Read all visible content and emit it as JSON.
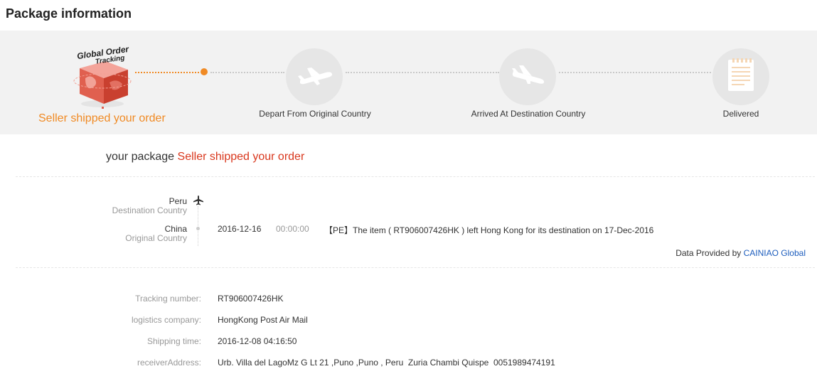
{
  "page_title": "Package information",
  "progress": {
    "logo_text": [
      "Global Order",
      "Tracking"
    ],
    "steps": [
      {
        "label": "Seller shipped your order",
        "icon": "global-order-tracking-icon",
        "state": "current"
      },
      {
        "label": "Depart From Original Country",
        "icon": "airplane-takeoff-icon",
        "state": "pending"
      },
      {
        "label": "Arrived At Destination Country",
        "icon": "airplane-landing-icon",
        "state": "pending"
      },
      {
        "label": "Delivered",
        "icon": "receipt-icon",
        "state": "pending"
      }
    ],
    "accent_color": "#f08a24"
  },
  "status": {
    "prefix": "your package",
    "value": "Seller shipped your order",
    "value_color": "#d9371d"
  },
  "route": {
    "destination": {
      "country": "Peru",
      "label": "Destination Country",
      "icon": "airplane-icon"
    },
    "origin": {
      "country": "China",
      "label": "Original Country"
    }
  },
  "events": [
    {
      "date": "2016-12-16",
      "time": "00:00:00",
      "description": "【PE】The item ( RT906007426HK ) left Hong Kong for its destination on 17-Dec-2016"
    }
  ],
  "provider": {
    "prefix": "Data Provided by",
    "name": "CAINIAO Global",
    "link_color": "#1d5dbd"
  },
  "details": [
    {
      "label": "Tracking number:",
      "value": "RT906007426HK"
    },
    {
      "label": "logistics company:",
      "value": "HongKong Post Air Mail"
    },
    {
      "label": "Shipping time:",
      "value": "2016-12-08 04:16:50"
    },
    {
      "label": "receiverAddress:",
      "value": "Urb. Villa del LagoMz G Lt 21 ,Puno ,Puno , Peru  Zuria Chambi Quispe  0051989474191"
    }
  ]
}
